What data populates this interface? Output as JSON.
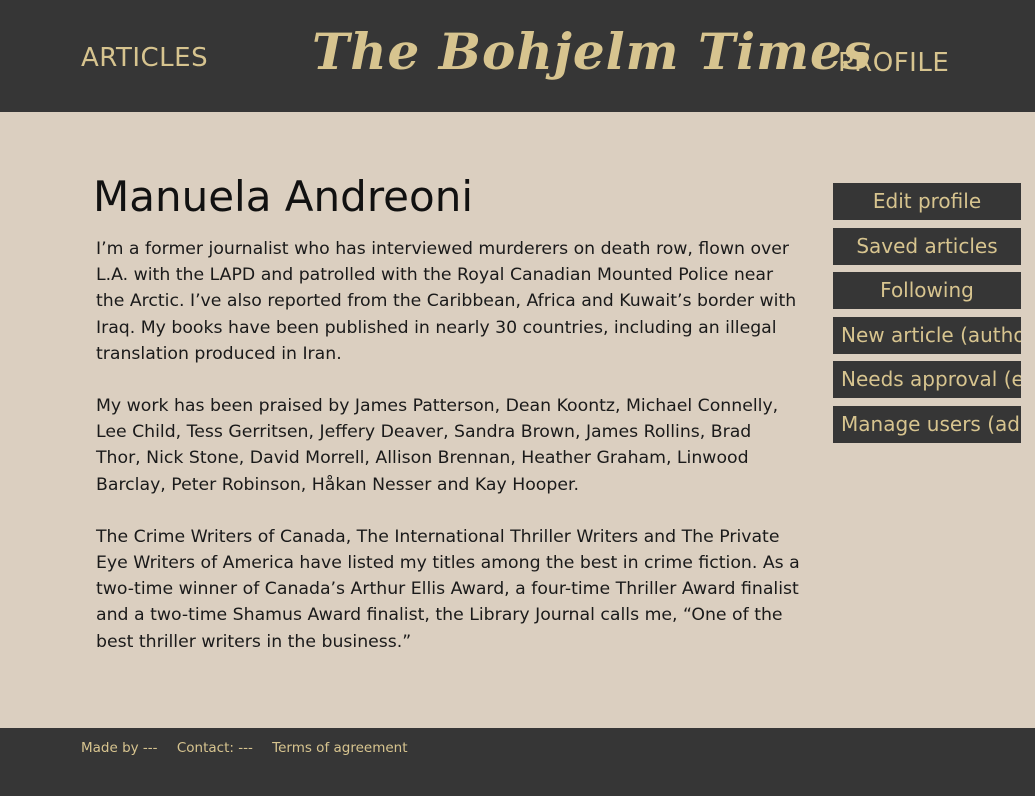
{
  "header": {
    "articles_label": "ARTICLES",
    "site_title": "The Bohjelm Times",
    "profile_label": "PROFILE"
  },
  "profile": {
    "name": "Manuela Andreoni",
    "bio": [
      "I’m a former journalist who has interviewed murderers on death row, flown over L.A. with the LAPD and patrolled with the Royal Canadian Mounted Police near the Arctic. I’ve also reported from the Caribbean, Africa and Kuwait’s border with Iraq. My books have been published in nearly 30 countries, including an illegal translation produced in Iran.",
      "My work has been praised by James Patterson, Dean Koontz, Michael Connelly, Lee Child, Tess Gerritsen, Jeffery Deaver, Sandra Brown, James Rollins, Brad Thor, Nick Stone, David Morrell, Allison Brennan, Heather Graham, Linwood Barclay, Peter Robinson, Håkan Nesser and Kay Hooper.",
      "The Crime Writers of Canada, The International Thriller Writers and The Private Eye Writers of America have listed my titles among the best in crime fiction. As a two-time winner of Canada’s Arthur Ellis Award, a four-time Thriller Award finalist and a two-time Shamus Award finalist, the Library Journal calls me, “One of the best thriller writers in the business.”"
    ]
  },
  "side_menu": {
    "edit_profile": "Edit profile",
    "saved_articles": "Saved articles",
    "following": "Following",
    "new_article": "New article (author)",
    "needs_approval": "Needs approval (editor)",
    "manage_users": "Manage users (admin)"
  },
  "footer": {
    "made_by": "Made by ---",
    "contact": "Contact: ---",
    "terms": "Terms of agreement"
  },
  "colors": {
    "bar_background": "#363636",
    "page_background": "#dbcfc0",
    "accent_gold": "#d7c48f"
  }
}
